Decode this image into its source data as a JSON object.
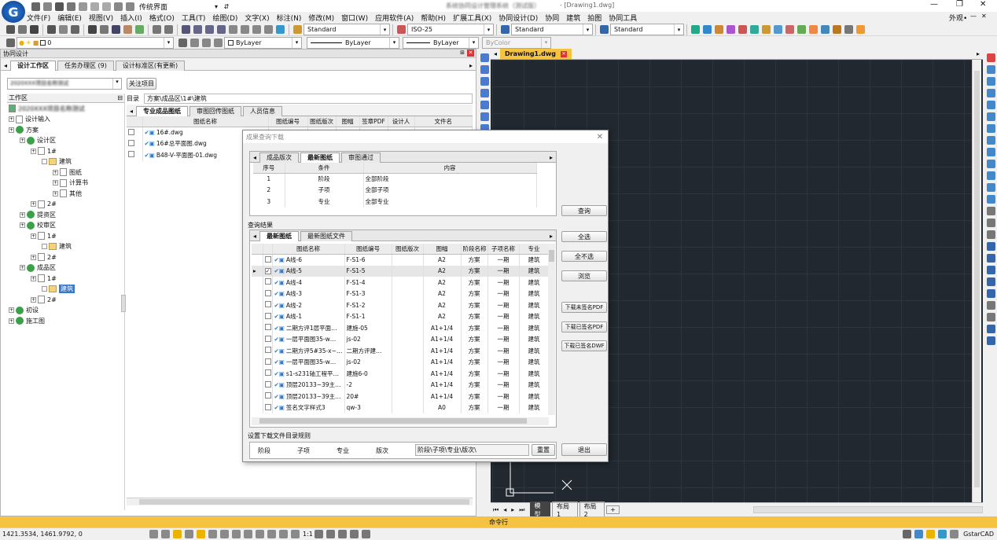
{
  "window": {
    "title": "{{title}} - [Drawing1.dwg]",
    "title_blur": "系统协同设计管理系统（测试版）",
    "workspace": "传统界面",
    "right_label": "外观•"
  },
  "menu": [
    "文件(F)",
    "编辑(E)",
    "视图(V)",
    "插入(I)",
    "格式(O)",
    "工具(T)",
    "绘图(D)",
    "文字(X)",
    "标注(N)",
    "修改(M)",
    "窗口(W)",
    "应用软件(A)",
    "帮助(H)",
    "扩展工具(X)",
    "协同设计(D)",
    "协同",
    "建筑",
    "拍图",
    "协同工具"
  ],
  "toolbar": {
    "textstyle": "Standard",
    "dimstyle": "ISO-25",
    "tablestyle": "Standard",
    "mleaderstyle": "Standard",
    "layer": "0",
    "color_layer": "ByLayer",
    "linetype": "ByLayer",
    "lineweight": "ByLayer",
    "plotstyle": "ByColor"
  },
  "left_panel": {
    "title": "协同设计",
    "tabs": [
      "设计工作区",
      "任务办理区 (9)",
      "设计标准区(有更新)"
    ],
    "project_combo": "2020XXX项目名称测试",
    "focus_btn": "关注项目",
    "workarea_label": "工作区",
    "dir_label": "目录",
    "path": "方案\\成品区\\1#\\建筑",
    "project_root": "2020XXX项目名称测试",
    "tree": [
      {
        "d": 0,
        "t": "设计输入",
        "i": "doc"
      },
      {
        "d": 0,
        "t": "方案",
        "i": "grn"
      },
      {
        "d": 1,
        "t": "设计区",
        "i": "grn"
      },
      {
        "d": 2,
        "t": "1#",
        "i": "doc"
      },
      {
        "d": 3,
        "t": "建筑",
        "i": "fld"
      },
      {
        "d": 4,
        "t": "图纸",
        "i": "doc"
      },
      {
        "d": 4,
        "t": "计算书",
        "i": "doc"
      },
      {
        "d": 4,
        "t": "其他",
        "i": "doc"
      },
      {
        "d": 2,
        "t": "2#",
        "i": "doc"
      },
      {
        "d": 1,
        "t": "提资区",
        "i": "grn"
      },
      {
        "d": 1,
        "t": "校审区",
        "i": "grn"
      },
      {
        "d": 2,
        "t": "1#",
        "i": "doc"
      },
      {
        "d": 3,
        "t": "建筑",
        "i": "fld"
      },
      {
        "d": 2,
        "t": "2#",
        "i": "doc"
      },
      {
        "d": 1,
        "t": "成品区",
        "i": "grn"
      },
      {
        "d": 2,
        "t": "1#",
        "i": "doc"
      },
      {
        "d": 3,
        "t": "建筑",
        "i": "fld",
        "sel": true
      },
      {
        "d": 2,
        "t": "2#",
        "i": "doc"
      },
      {
        "d": 0,
        "t": "初设",
        "i": "grn"
      },
      {
        "d": 0,
        "t": "施工图",
        "i": "grn"
      }
    ],
    "file_tabs": [
      "专业成品图纸",
      "审图回传图纸",
      "人员信息"
    ],
    "file_cols": [
      "图纸名称",
      "图纸编号",
      "图纸版次",
      "图幅",
      "签章PDF",
      "设计人",
      "文件名"
    ],
    "files": [
      "16#.dwg",
      "16#总平面图.dwg",
      "B48-V-平面图-01.dwg"
    ]
  },
  "dialog": {
    "title": "成果查询下载",
    "qtabs": [
      "成品版次",
      "最新图纸",
      "审图通过"
    ],
    "cond_cols": [
      "序号",
      "条件",
      "内容"
    ],
    "conds": [
      [
        "1",
        "阶段",
        "全部阶段"
      ],
      [
        "2",
        "子项",
        "全部子项"
      ],
      [
        "3",
        "专业",
        "全部专业"
      ]
    ],
    "query_btn": "查询",
    "result_label": "查询结果",
    "rtabs": [
      "最新图纸",
      "最新图纸文件"
    ],
    "rcols": [
      "图纸名称",
      "图纸编号",
      "图纸版次",
      "图幅",
      "阶段名称",
      "子项名称",
      "专业"
    ],
    "rows": [
      [
        "A线-6",
        "F-S1-6",
        "",
        "A2",
        "方案",
        "一期",
        "建筑"
      ],
      [
        "A线-5",
        "F-S1-5",
        "",
        "A2",
        "方案",
        "一期",
        "建筑"
      ],
      [
        "A线-4",
        "F-S1-4",
        "",
        "A2",
        "方案",
        "一期",
        "建筑"
      ],
      [
        "A线-3",
        "F-S1-3",
        "",
        "A2",
        "方案",
        "一期",
        "建筑"
      ],
      [
        "A线-2",
        "F-S1-2",
        "",
        "A2",
        "方案",
        "一期",
        "建筑"
      ],
      [
        "A线-1",
        "F-S1-1",
        "",
        "A2",
        "方案",
        "一期",
        "建筑"
      ],
      [
        "二期方评1层平面…",
        "建施-05",
        "",
        "A1+1/4",
        "方案",
        "一期",
        "建筑"
      ],
      [
        "一层平面图35-w…",
        "js-02",
        "",
        "A1+1/4",
        "方案",
        "一期",
        "建筑"
      ],
      [
        "二期方评5#35-x~…",
        "二期方评建…",
        "",
        "A1+1/4",
        "方案",
        "一期",
        "建筑"
      ],
      [
        "一层平面图35-w…",
        "js-02",
        "",
        "A1+1/4",
        "方案",
        "一期",
        "建筑"
      ],
      [
        "s1-s231轴工程平…",
        "建施6-0",
        "",
        "A1+1/4",
        "方案",
        "一期",
        "建筑"
      ],
      [
        "顶层20133~39主…",
        "-2",
        "",
        "A1+1/4",
        "方案",
        "一期",
        "建筑"
      ],
      [
        "顶层20133~39主…",
        "20#",
        "",
        "A1+1/4",
        "方案",
        "一期",
        "建筑"
      ],
      [
        "签名文字样式3",
        "qw-3",
        "",
        "A0",
        "方案",
        "一期",
        "建筑"
      ]
    ],
    "side_btns": [
      "全选",
      "全不选",
      "浏览",
      "下载未签名PDF",
      "下载已签名PDF",
      "下载已签名DWF"
    ],
    "dl_rule_label": "设置下载文件目录规则",
    "rule_parts": [
      "阶段",
      "子项",
      "专业",
      "版次"
    ],
    "rule_value": "阶段\\子项\\专业\\版次\\",
    "reset_btn": "重置",
    "exit_btn": "退出"
  },
  "drawing": {
    "tab": "Drawing1.dwg",
    "layout_tabs": [
      "模型",
      "布局1",
      "布局2",
      "+"
    ]
  },
  "cmdline": "命令行",
  "status": {
    "coords": "1421.3534, 1461.9792, 0",
    "scale": "1:1",
    "brand": "GstarCAD"
  },
  "colors": {
    "canvas": "#212830",
    "accent": "#f5c341",
    "selection": "#3a78c9"
  }
}
